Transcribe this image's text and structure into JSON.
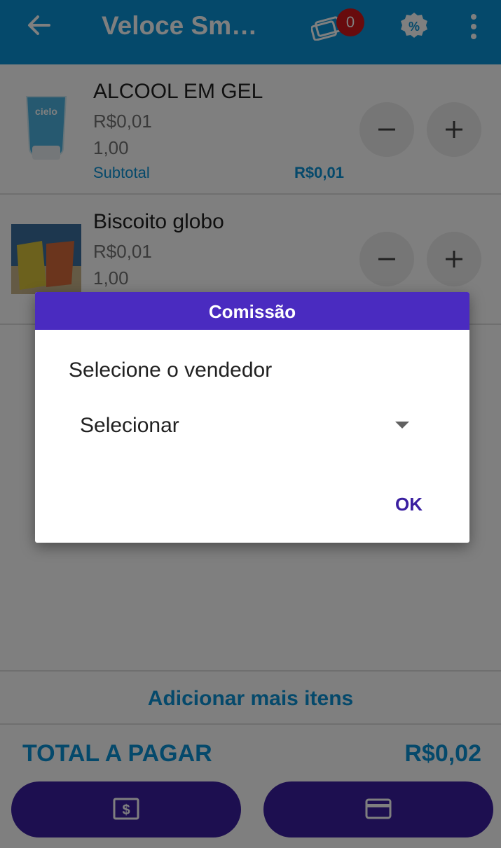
{
  "app_bar": {
    "title": "Veloce Sm…",
    "badge_count": "0",
    "icons": [
      "back-arrow-icon",
      "cards-icon",
      "discount-icon",
      "more-vert-icon"
    ],
    "color": "#0a93d6"
  },
  "items": [
    {
      "name": "ALCOOL EM GEL",
      "price": "R$0,01",
      "quantity": "1,00",
      "subtotal_label": "Subtotal",
      "subtotal_value": "R$0,01",
      "thumb_text": "cielo"
    },
    {
      "name": "Biscoito globo",
      "price": "R$0,01",
      "quantity": "1,00"
    }
  ],
  "footer": {
    "add_more": "Adicionar mais itens",
    "total_label": "TOTAL A PAGAR",
    "total_value": "R$0,02",
    "buttons": [
      "cash-icon",
      "credit-card-icon"
    ]
  },
  "dialog": {
    "title": "Comissão",
    "prompt": "Selecione o vendedor",
    "select_value": "Selecionar",
    "ok_label": "OK",
    "header_color": "#4a2bc0"
  }
}
